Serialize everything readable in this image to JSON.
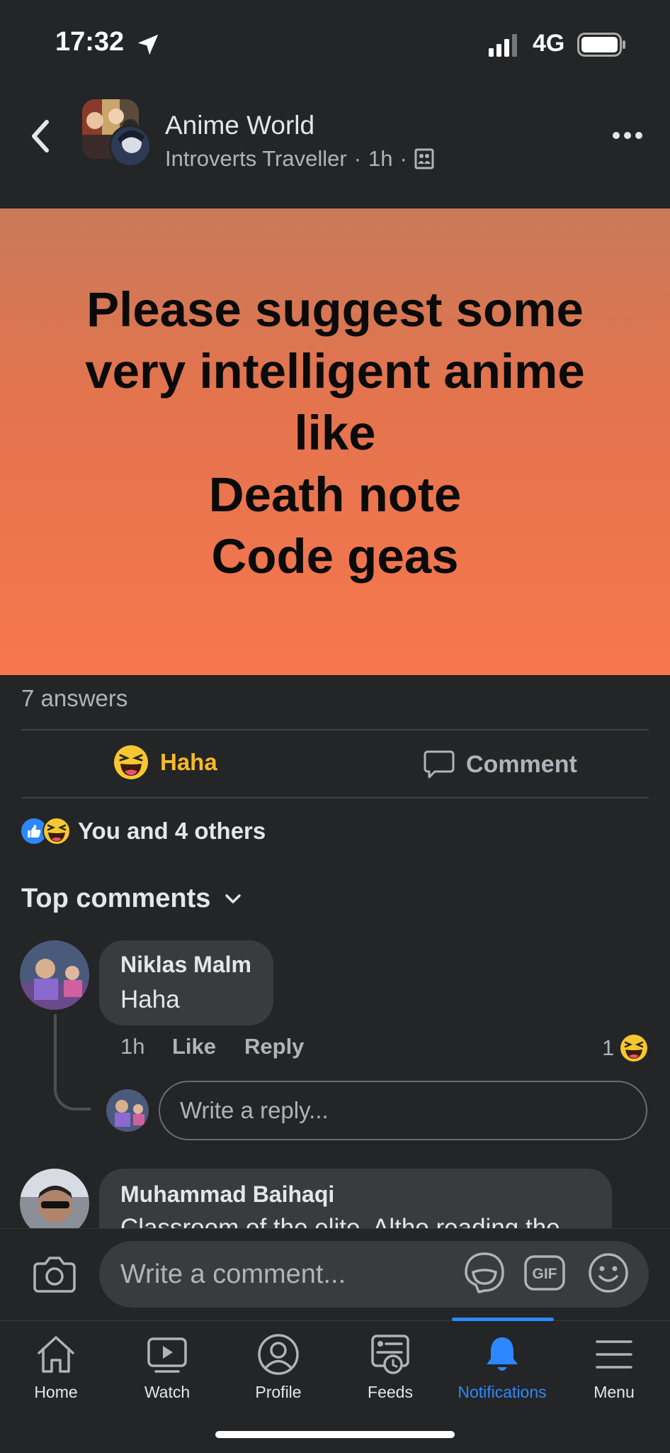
{
  "status_bar": {
    "time": "17:32",
    "network": "4G"
  },
  "header": {
    "group_name": "Anime World",
    "author": "Introverts Traveller",
    "time": "1h",
    "separator": "·"
  },
  "post": {
    "text": "Please suggest some\nvery intelligent anime\nlike\nDeath note\nCode geas",
    "answers": "7 answers"
  },
  "actions": {
    "haha": "Haha",
    "comment": "Comment"
  },
  "reactions": {
    "summary": "You and 4 others"
  },
  "comments_section": {
    "title": "Top comments"
  },
  "comments": [
    {
      "name": "Niklas Malm",
      "text": "Haha",
      "time": "1h",
      "like": "Like",
      "reply": "Reply",
      "reaction_count": "1"
    },
    {
      "name": "Muhammad Baihaqi",
      "text": "Classroom of the elite. Altho reading the"
    }
  ],
  "reply_box": {
    "placeholder": "Write a reply..."
  },
  "composer": {
    "placeholder": "Write a comment...",
    "gif": "GIF"
  },
  "tabs": [
    {
      "label": "Home",
      "icon": "home-icon"
    },
    {
      "label": "Watch",
      "icon": "watch-icon"
    },
    {
      "label": "Profile",
      "icon": "profile-icon"
    },
    {
      "label": "Feeds",
      "icon": "feeds-icon"
    },
    {
      "label": "Notifications",
      "icon": "bell-icon",
      "active": true
    },
    {
      "label": "Menu",
      "icon": "menu-icon"
    }
  ],
  "colors": {
    "accent": "#2d88ff",
    "haha": "#f7b928",
    "background": "#242526",
    "post_gradient_top": "#c97a5a",
    "post_gradient_bottom": "#f7764d"
  }
}
